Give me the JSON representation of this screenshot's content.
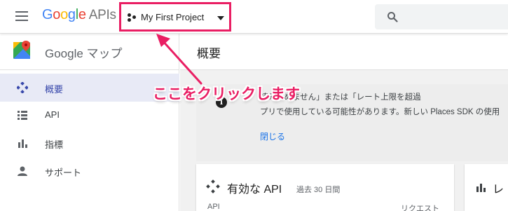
{
  "header": {
    "logo": {
      "g1": "G",
      "g2": "o",
      "g3": "o",
      "g4": "g",
      "g5": "l",
      "g6": "e",
      "apis": "APIs"
    },
    "project_name": "My First Project",
    "search_icon": "search-icon"
  },
  "sidebar": {
    "api_title": "Google マップ",
    "items": [
      {
        "label": "概要",
        "icon": "overview-diamond-icon",
        "active": true
      },
      {
        "label": "API",
        "icon": "list-icon",
        "active": false
      },
      {
        "label": "指標",
        "icon": "bar-chart-icon",
        "active": false
      },
      {
        "label": "サポート",
        "icon": "person-icon",
        "active": false
      }
    ]
  },
  "main": {
    "page_title": "概要",
    "notice": {
      "line1": "読み込めません」または「レート上限を超過",
      "line2": "プリで使用している可能性があります。新しい Places SDK の使用",
      "close_label": "閉じる"
    },
    "card1": {
      "title": "有効な API",
      "subtitle": "過去 30 日間",
      "col_api": "API",
      "col_requests": "リクエスト"
    },
    "card2": {
      "title": "レ"
    }
  },
  "annotation": {
    "text": "ここをクリックします"
  },
  "colors": {
    "accent": "#e91e63",
    "active_nav": "#3949ab",
    "link": "#1a73e8"
  }
}
